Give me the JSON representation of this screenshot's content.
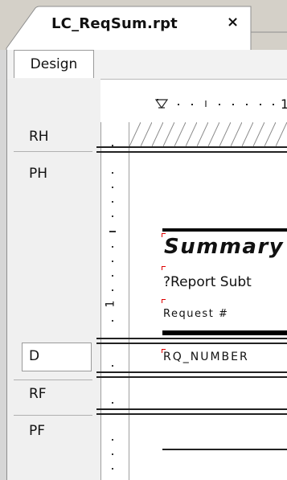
{
  "tab": {
    "label": "LC_ReqSum.rpt",
    "close": "×"
  },
  "view_tab": {
    "label": "Design"
  },
  "ruler": {
    "mark": "1"
  },
  "sections": [
    {
      "label": "RH"
    },
    {
      "label": "PH"
    },
    {
      "label": "D"
    },
    {
      "label": "RF"
    },
    {
      "label": "PF"
    }
  ],
  "vruler": {
    "mark": "1"
  },
  "report": {
    "title": "Summary",
    "subtitle": "?Report Subt",
    "column_header": "Request #",
    "detail_field": "RQ_NUMBER"
  }
}
